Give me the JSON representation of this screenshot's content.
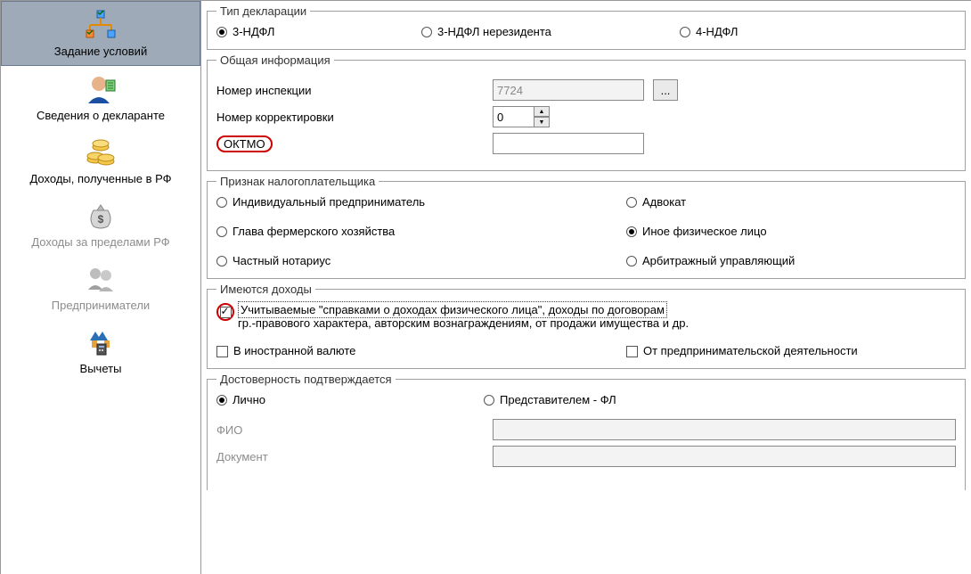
{
  "sidebar": {
    "items": [
      {
        "label": "Задание условий"
      },
      {
        "label": "Сведения о декларанте"
      },
      {
        "label": "Доходы, полученные в РФ"
      },
      {
        "label": "Доходы за пределами РФ"
      },
      {
        "label": "Предприниматели"
      },
      {
        "label": "Вычеты"
      }
    ]
  },
  "decl_type": {
    "legend": "Тип декларации",
    "options": [
      "3-НДФЛ",
      "3-НДФЛ нерезидента",
      "4-НДФЛ"
    ]
  },
  "general": {
    "legend": "Общая информация",
    "inspection_label": "Номер инспекции",
    "inspection_value": "7724",
    "correction_label": "Номер корректировки",
    "correction_value": "0",
    "oktmo_label": "ОКТМО",
    "oktmo_value": ""
  },
  "taxpayer": {
    "legend": "Признак налогоплательщика",
    "options": {
      "ip": "Индивидуальный предприниматель",
      "lawyer": "Адвокат",
      "farm": "Глава фермерского хозяйства",
      "other_person": "Иное физическое лицо",
      "notary": "Частный нотариус",
      "arbitr": "Арбитражный управляющий"
    }
  },
  "income": {
    "legend": "Имеются доходы",
    "main_line1": "Учитываемые \"справками о доходах физического лица\", доходы по договорам",
    "main_line2": "гр.-правового характера, авторским вознаграждениям, от продажи имущества и др.",
    "foreign": "В иностранной валюте",
    "biz": "От предпринимательской деятельности"
  },
  "trust": {
    "legend": "Достоверность подтверждается",
    "self": "Лично",
    "rep": "Представителем - ФЛ",
    "fio_label": "ФИО",
    "doc_label": "Документ"
  }
}
